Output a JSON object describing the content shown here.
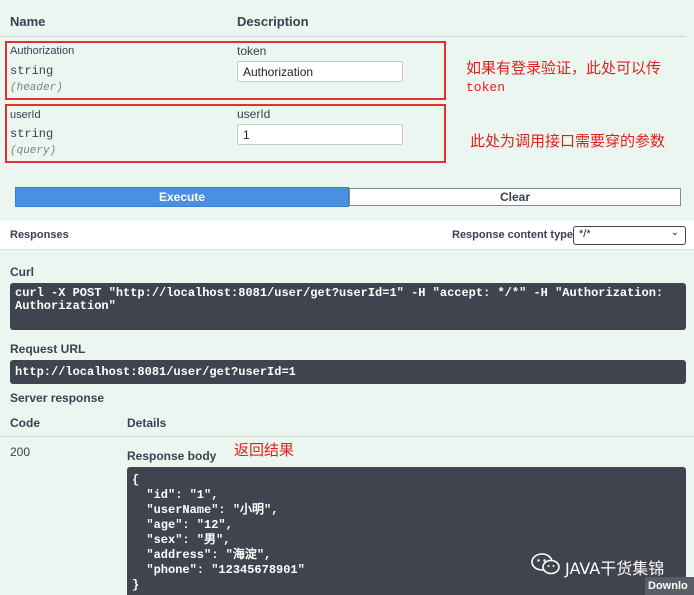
{
  "params_table": {
    "col_name": "Name",
    "col_description": "Description"
  },
  "params": [
    {
      "name": "Authorization",
      "type": "string",
      "in": "(header)",
      "desc_label": "token",
      "value": "Authorization"
    },
    {
      "name": "userId",
      "type": "string",
      "in": "(query)",
      "desc_label": "userId",
      "value": "1"
    }
  ],
  "annotations": {
    "header_note_line1": "如果有登录验证，此处可以传",
    "header_note_line2": "token",
    "query_note": "此处为调用接口需要穿的参数",
    "result_note": "返回结果"
  },
  "actions": {
    "execute_label": "Execute",
    "clear_label": "Clear"
  },
  "responses": {
    "title": "Responses",
    "content_type_label": "Response content type",
    "content_type_value": "*/*"
  },
  "curl": {
    "label": "Curl",
    "line1": "curl -X POST \"http://localhost:8081/user/get?userId=1\" -H \"accept: */*\" -H \"Authorization:",
    "line2": "Authorization\""
  },
  "request_url": {
    "label": "Request URL",
    "value": "http://localhost:8081/user/get?userId=1"
  },
  "server_response": {
    "label": "Server response",
    "col_code": "Code",
    "col_details": "Details",
    "code": "200",
    "body_label": "Response body",
    "body_lines": [
      "{",
      "  \"id\": \"1\",",
      "  \"userName\": \"小明\",",
      "  \"age\": \"12\",",
      "  \"sex\": \"男\",",
      "  \"address\": \"海淀\",",
      "  \"phone\": \"12345678901\"",
      "}"
    ],
    "download_label": "Downlo"
  },
  "watermark": {
    "text": "JAVA干货集锦"
  }
}
